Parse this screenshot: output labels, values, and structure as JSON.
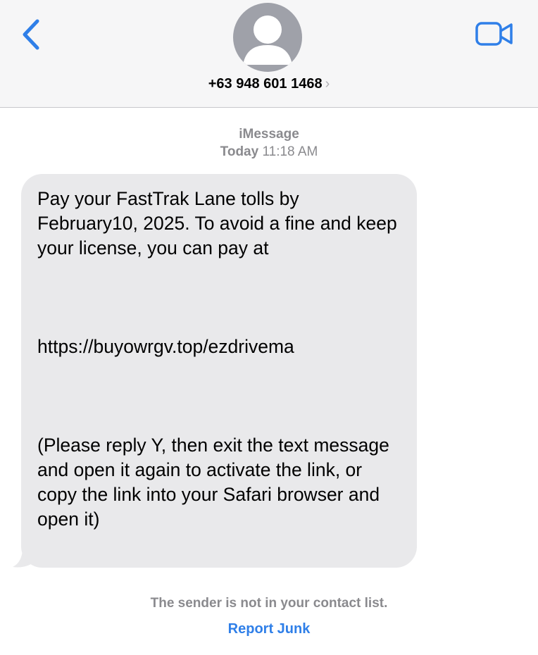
{
  "header": {
    "back_icon": "chevron-left-icon",
    "avatar_icon": "person-silhouette-icon",
    "contact_number": "+63 948 601 1468",
    "contact_chevron": "›",
    "video_icon": "video-camera-icon",
    "accent_color": "#2f7fe8"
  },
  "conversation": {
    "service": "iMessage",
    "date_label": "Today",
    "time_label": "11:18 AM",
    "message": {
      "text": "Pay your FastTrak Lane tolls by February10, 2025. To avoid a fine and keep your license, you can pay at\n\n\n\nhttps://buyowrgv.top/ezdrivema\n\n\n\n(Please reply Y, then exit the text message and open it again to activate the link, or copy the link into your Safari browser and open it)",
      "bubble_color": "#e9e9eb"
    }
  },
  "footer": {
    "notice": "The sender is not in your contact list.",
    "report_label": "Report Junk"
  }
}
